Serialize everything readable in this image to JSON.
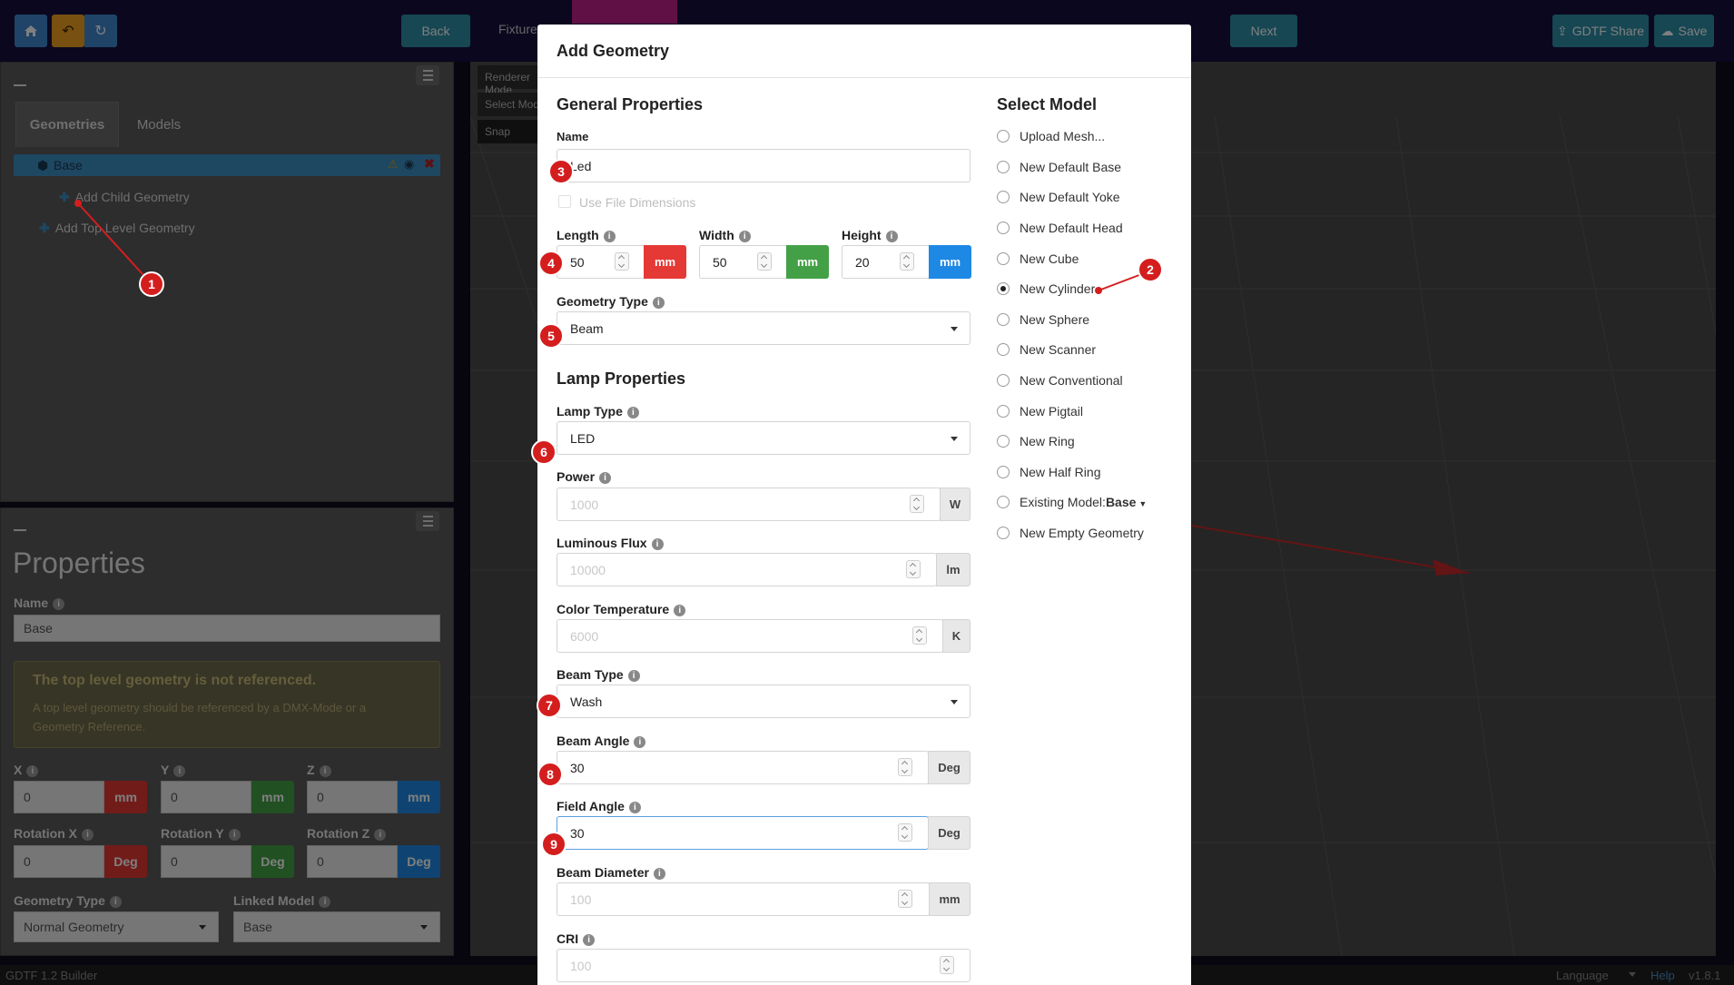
{
  "topbar": {
    "back_label": "Back",
    "fixture_label": "Fixture",
    "next_label": "Next",
    "share_label": "GDTF Share",
    "save_label": "Save"
  },
  "tree": {
    "tabs": [
      "Geometries",
      "Models"
    ],
    "base_label": "Base",
    "add_child_label": "Add Child Geometry",
    "add_top_label": "Add Top Level Geometry"
  },
  "properties": {
    "title": "Properties",
    "name_label": "Name",
    "name_value": "Base",
    "warning_title": "The top level geometry is not referenced.",
    "warning_text": "A top level geometry should be referenced by a DMX-Mode or a Geometry Reference.",
    "x_label": "X",
    "y_label": "Y",
    "z_label": "Z",
    "x_value": "0",
    "y_value": "0",
    "z_value": "0",
    "unit_mm": "mm",
    "rx_label": "Rotation X",
    "ry_label": "Rotation Y",
    "rz_label": "Rotation Z",
    "rx_value": "0",
    "ry_value": "0",
    "rz_value": "0",
    "unit_deg": "Deg",
    "geotype_label": "Geometry Type",
    "geotype_value": "Normal Geometry",
    "linked_label": "Linked Model",
    "linked_value": "Base"
  },
  "viewport": {
    "renderer_label": "Renderer Mode",
    "select_label": "Select Mode",
    "snap_label": "Snap"
  },
  "modal": {
    "title": "Add Geometry",
    "general_heading": "General Properties",
    "name_label": "Name",
    "name_value": "Led",
    "use_file_dims": "Use File Dimensions",
    "length_label": "Length",
    "length_value": "50",
    "width_label": "Width",
    "width_value": "50",
    "height_label": "Height",
    "height_value": "20",
    "unit_mm": "mm",
    "geometry_type_label": "Geometry Type",
    "geometry_type_value": "Beam",
    "lamp_heading": "Lamp Properties",
    "lamp_type_label": "Lamp Type",
    "lamp_type_value": "LED",
    "power_label": "Power",
    "power_value": "1000",
    "power_unit": "W",
    "flux_label": "Luminous Flux",
    "flux_value": "10000",
    "flux_unit": "lm",
    "ct_label": "Color Temperature",
    "ct_value": "6000",
    "ct_unit": "K",
    "beam_type_label": "Beam Type",
    "beam_type_value": "Wash",
    "beam_angle_label": "Beam Angle",
    "beam_angle_value": "30",
    "deg_unit": "Deg",
    "field_angle_label": "Field Angle",
    "field_angle_value": "30",
    "beam_diam_label": "Beam Diameter",
    "beam_diam_value": "100",
    "cri_label": "CRI",
    "cri_value": "100",
    "select_model_heading": "Select Model",
    "models": [
      "Upload Mesh...",
      "New Default Base",
      "New Default Yoke",
      "New Default Head",
      "New Cube",
      "New Cylinder",
      "New Sphere",
      "New Scanner",
      "New Conventional",
      "New Pigtail",
      "New Ring",
      "New Half Ring",
      "Existing Model:",
      "New Empty Geometry"
    ],
    "existing_model_value": "Base",
    "selected_model": "New Cylinder"
  },
  "badges": [
    "1",
    "2",
    "3",
    "4",
    "5",
    "6",
    "7",
    "8",
    "9"
  ],
  "status": {
    "app_name": "GDTF 1.2 Builder",
    "language": "Language",
    "help": "Help",
    "version": "v1.8.1"
  },
  "colors": {
    "x_axis": "#e53935",
    "y_axis": "#43a047",
    "z_axis": "#1e88e5",
    "badge": "#d41e1e"
  }
}
